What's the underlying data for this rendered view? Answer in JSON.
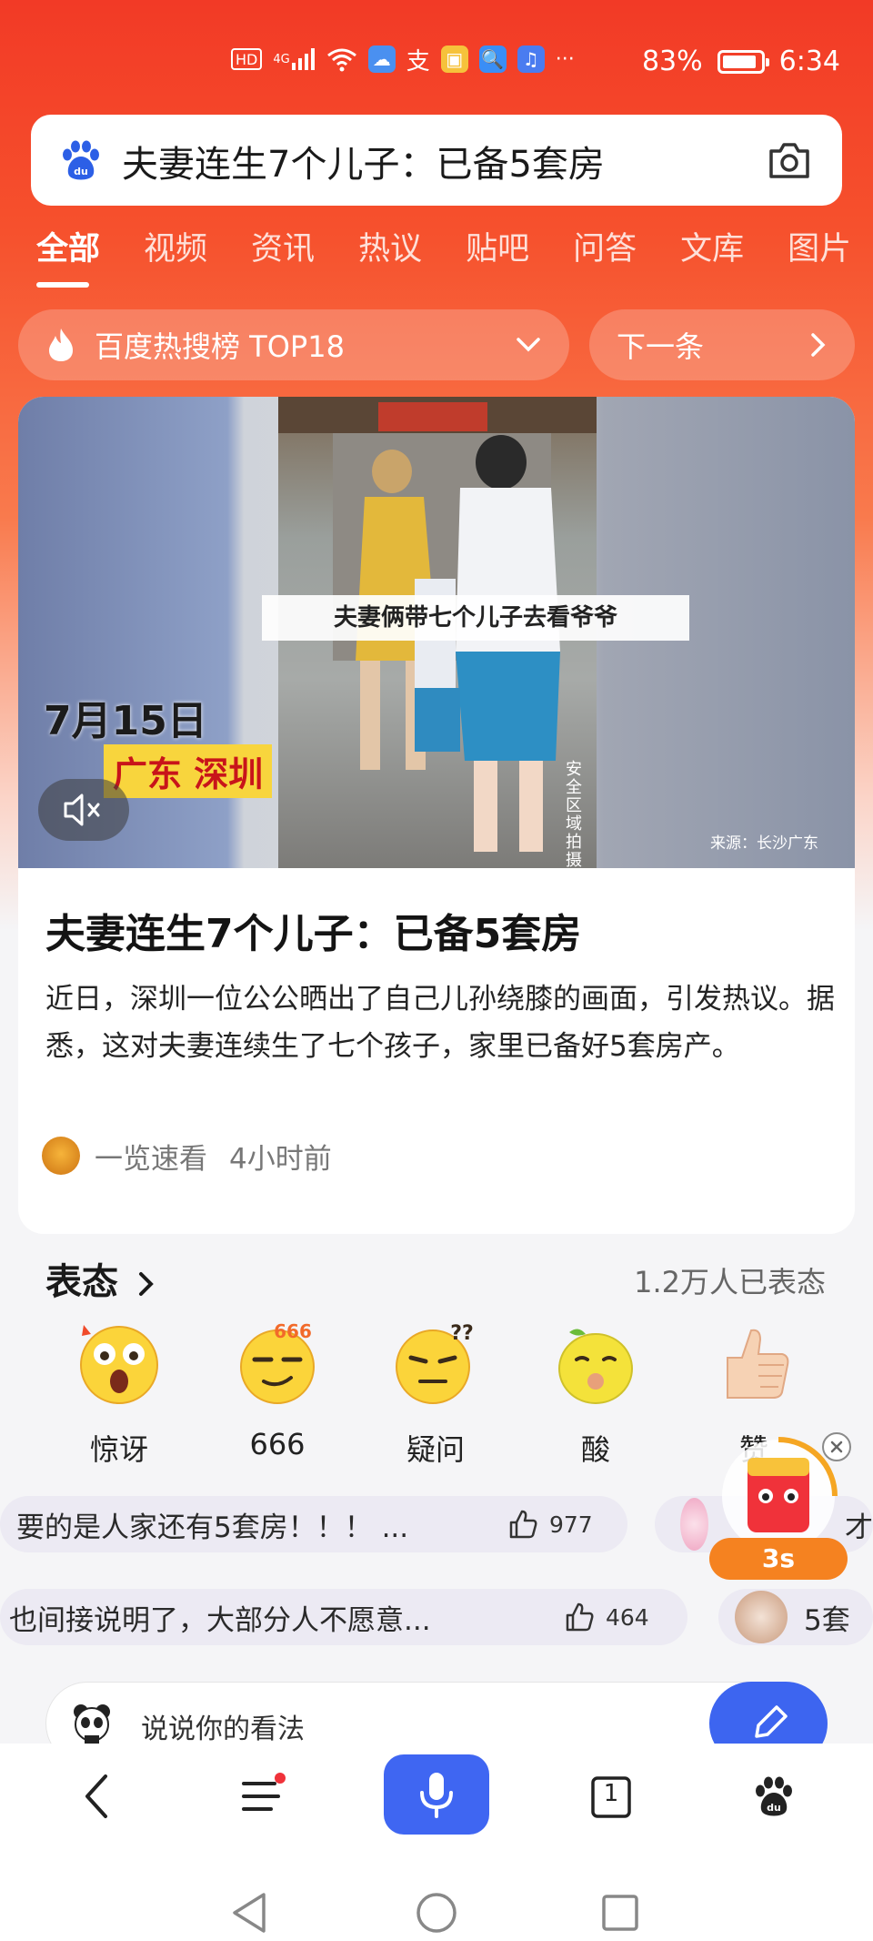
{
  "status_bar": {
    "hd": "HD",
    "network": "4G",
    "alipay_glyph": "支",
    "more": "···",
    "battery": "83%",
    "time": "6:34"
  },
  "search": {
    "query": "夫妻连生7个儿子：已备5套房"
  },
  "tabs": [
    "全部",
    "视频",
    "资讯",
    "热议",
    "贴吧",
    "问答",
    "文库",
    "图片"
  ],
  "hot_pill": {
    "label": "百度热搜榜 TOP18"
  },
  "next_pill": {
    "label": "下一条"
  },
  "video": {
    "date": "7月15日",
    "place": "广东 深圳",
    "caption": "夫妻俩带七个儿子去看爷爷",
    "side_text": "安全区域拍摄",
    "source": "来源：长沙广东"
  },
  "article": {
    "title": "夫妻连生7个儿子：已备5套房",
    "desc": "近日，深圳一位公公晒出了自己儿孙绕膝的画面，引发热议。据悉，这对夫妻连续生了七个孩子，家里已备好5套房产。",
    "source_name": "一览速看",
    "time": "4小时前"
  },
  "reactions": {
    "title": "表态",
    "count": "1.2万人已表态",
    "items": [
      {
        "label": "惊讶"
      },
      {
        "label": "666"
      },
      {
        "label": "疑问"
      },
      {
        "label": "酸"
      },
      {
        "label": "赞"
      }
    ]
  },
  "comments": [
    {
      "text": "要的是人家还有5套房！！！ ...",
      "likes": "977",
      "side": "才"
    },
    {
      "text": "也间接说明了，大部分人不愿意...",
      "likes": "464",
      "side": "5套"
    }
  ],
  "float_widget": {
    "timer": "3s"
  },
  "input": {
    "placeholder": "说说你的看法"
  },
  "nav": {
    "tab_count": "1"
  },
  "colors": {
    "brand_red": "#f23a26",
    "accent_blue": "#3f66f2"
  }
}
